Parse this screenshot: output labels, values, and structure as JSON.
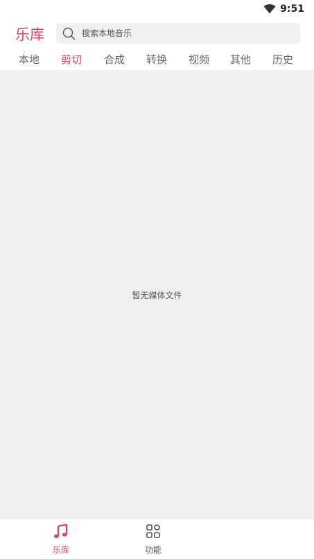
{
  "status_bar": {
    "time": "9:51",
    "wifi_icon": "wifi-icon"
  },
  "header": {
    "title": "乐库",
    "search": {
      "placeholder": "搜索本地音乐",
      "value": "",
      "icon": "search-icon"
    }
  },
  "tabs": [
    {
      "label": "本地",
      "active": false
    },
    {
      "label": "剪切",
      "active": true
    },
    {
      "label": "合成",
      "active": false
    },
    {
      "label": "转换",
      "active": false
    },
    {
      "label": "视频",
      "active": false
    },
    {
      "label": "其他",
      "active": false
    },
    {
      "label": "历史",
      "active": false
    }
  ],
  "content": {
    "empty_message": "暂无媒体文件"
  },
  "bottom_nav": [
    {
      "label": "乐库",
      "icon": "music-note-icon",
      "active": true
    },
    {
      "label": "功能",
      "icon": "grid-icon",
      "active": false
    }
  ],
  "colors": {
    "accent": "#d24868",
    "content_bg": "#f0f0f0",
    "search_bg": "#f1f1f1"
  }
}
